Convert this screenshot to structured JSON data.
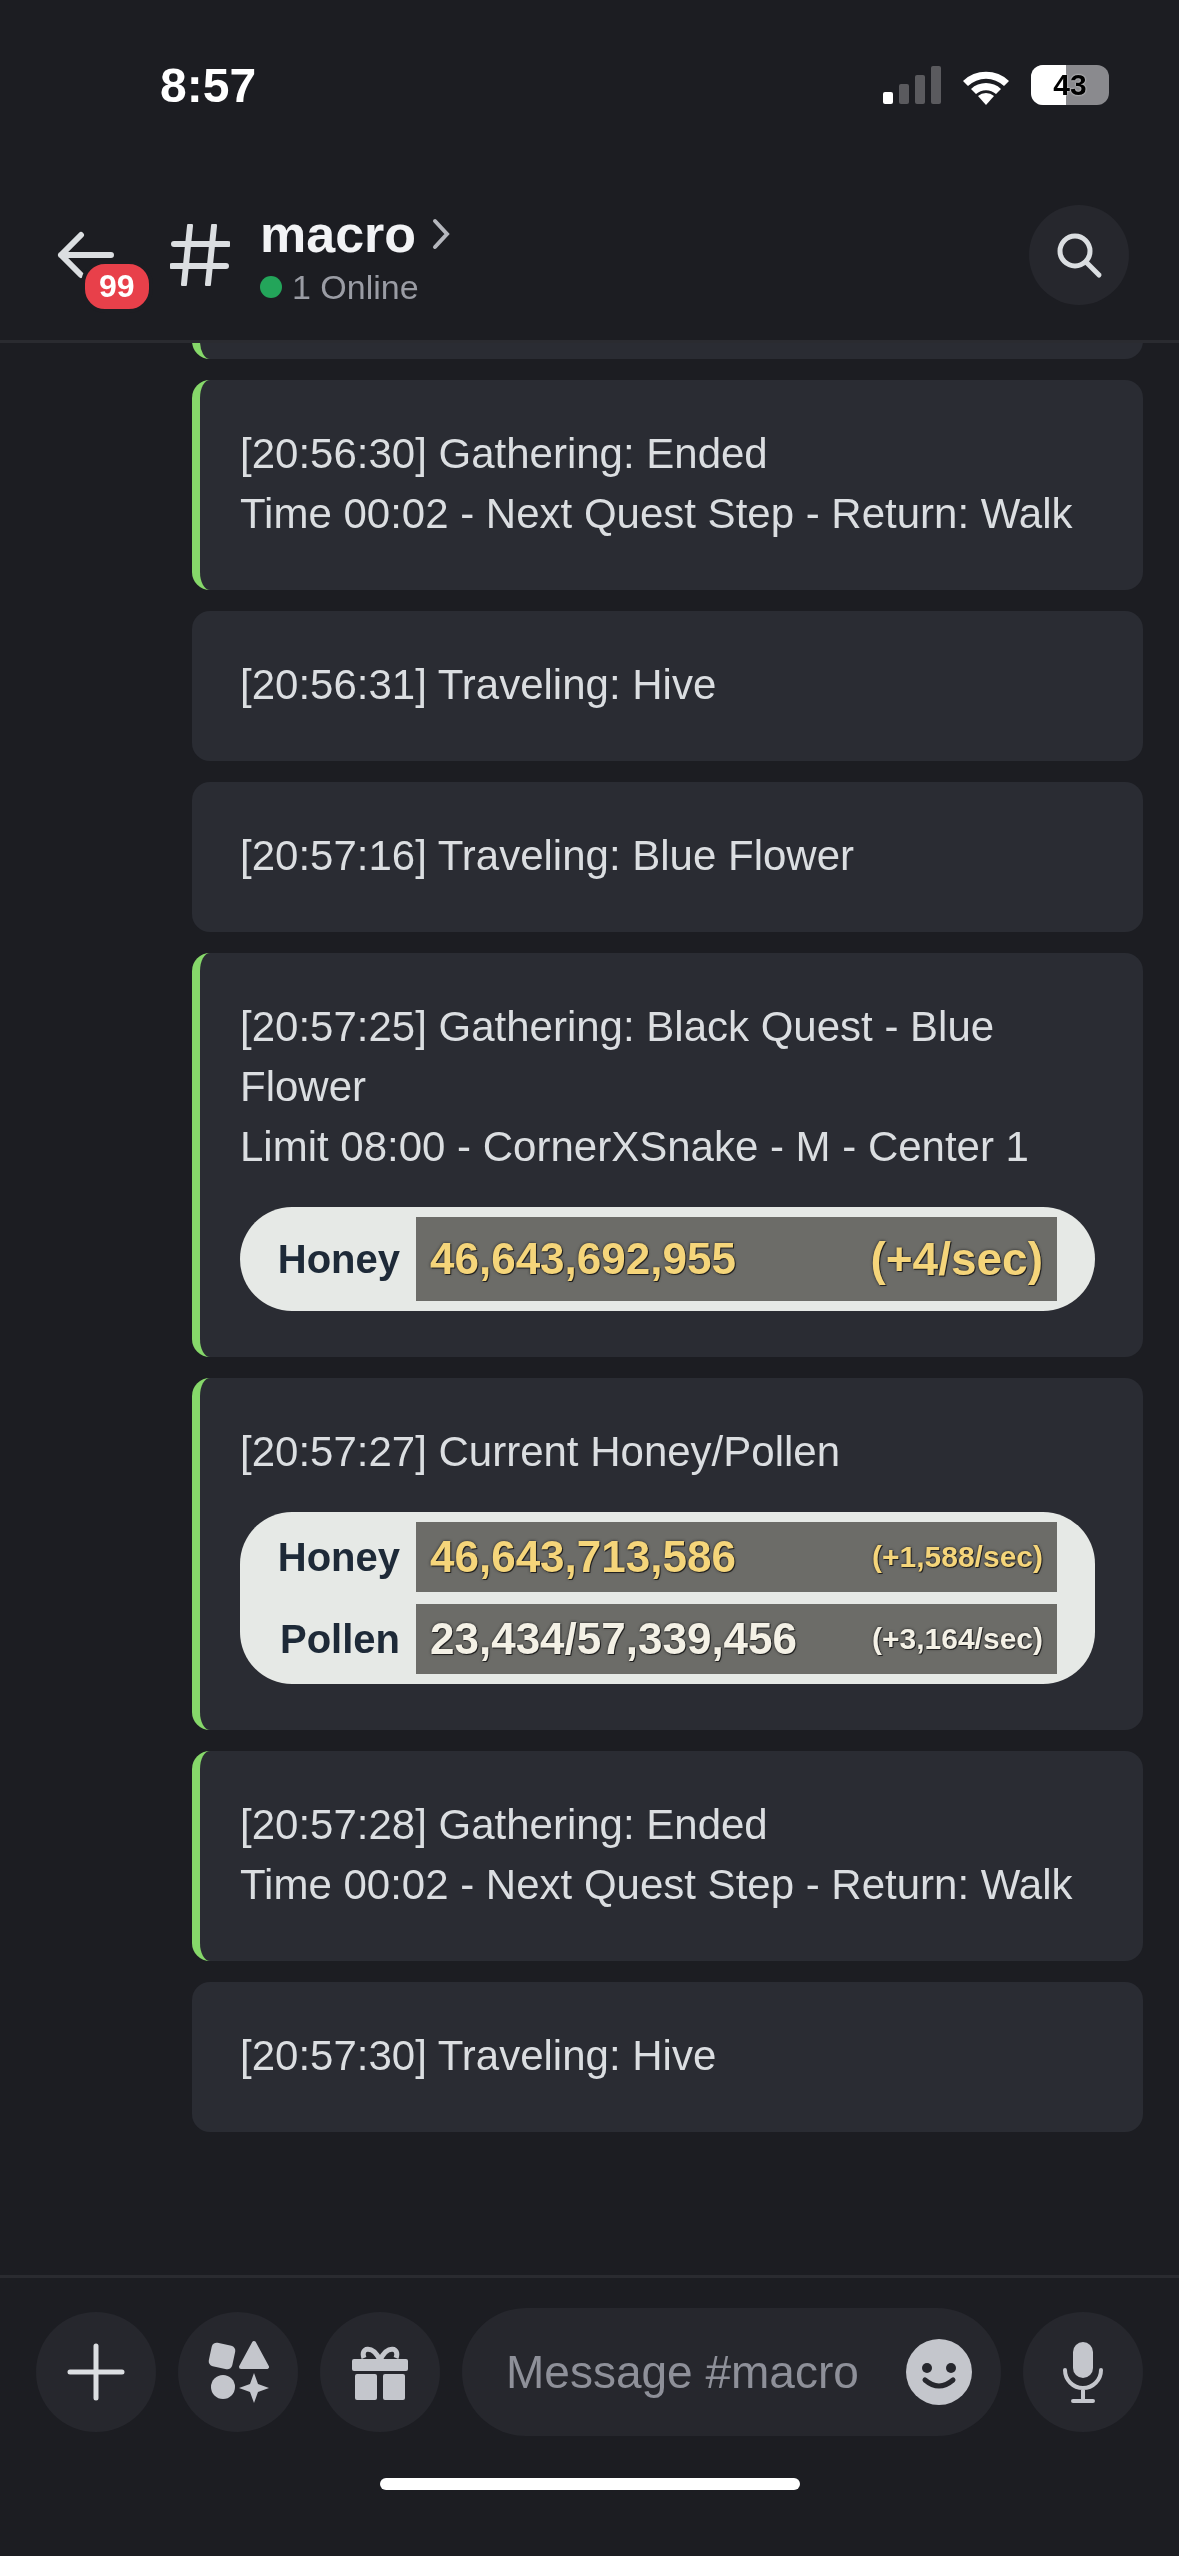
{
  "status_bar": {
    "time": "8:57",
    "battery": "43"
  },
  "header": {
    "unread_badge": "99",
    "channel": "macro",
    "online": "1 Online"
  },
  "messages": [
    {
      "accent": true,
      "lines": [
        "[20:56:30] Gathering: Ended",
        "Time 00:02 - Next Quest Step - Return: Walk"
      ]
    },
    {
      "accent": false,
      "lines": [
        "[20:56:31] Traveling: Hive"
      ]
    },
    {
      "accent": false,
      "lines": [
        "[20:57:16] Traveling: Blue Flower"
      ]
    },
    {
      "accent": true,
      "lines": [
        "[20:57:25] Gathering: Black Quest - Blue Flower",
        "Limit 08:00 - CornerXSnake - M - Center 1"
      ],
      "stats": [
        {
          "kind": "honey",
          "label": "Honey",
          "value": "46,643,692,955",
          "rate": "(+4/sec)"
        }
      ]
    },
    {
      "accent": true,
      "lines": [
        "[20:57:27] Current Honey/Pollen"
      ],
      "stats": [
        {
          "kind": "honey",
          "label": "Honey",
          "value": "46,643,713,586",
          "rate": "(+1,588/sec)"
        },
        {
          "kind": "pollen",
          "label": "Pollen",
          "value": "23,434/57,339,456",
          "rate": "(+3,164/sec)"
        }
      ]
    },
    {
      "accent": true,
      "lines": [
        "[20:57:28] Gathering: Ended",
        "Time 00:02 - Next Quest Step - Return: Walk"
      ]
    },
    {
      "accent": false,
      "lines": [
        "[20:57:30] Traveling: Hive"
      ]
    }
  ],
  "composer": {
    "placeholder": "Message #macro"
  }
}
